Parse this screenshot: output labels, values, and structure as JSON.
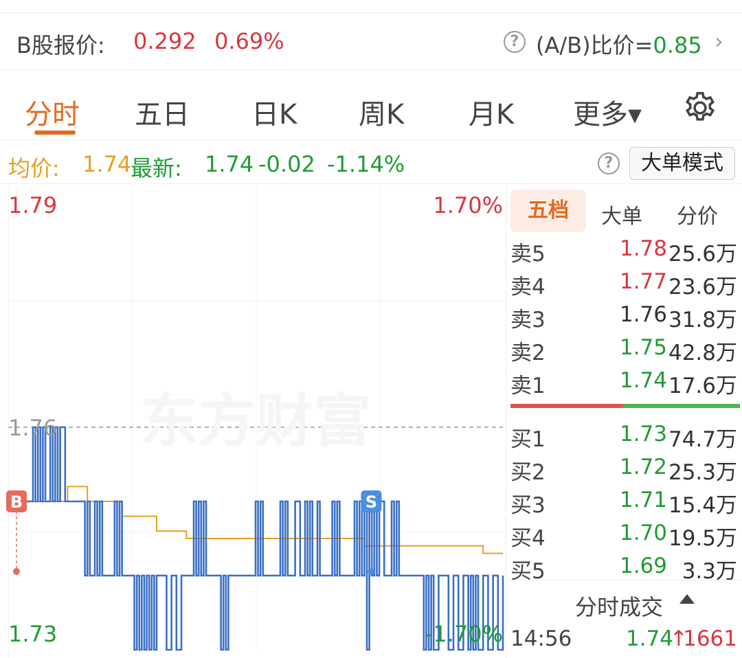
{
  "quote": {
    "label": "B股报价:",
    "price": "0.292",
    "change_pct": "0.69%",
    "ratio_label": "(A/B)比价=",
    "ratio_value": "0.85",
    "help": "?",
    "chevron": "›"
  },
  "tabs": [
    {
      "label": "分时",
      "active": true
    },
    {
      "label": "五日"
    },
    {
      "label": "日K"
    },
    {
      "label": "周K"
    },
    {
      "label": "月K"
    },
    {
      "label": "更多▾"
    }
  ],
  "settings_icon": "gear-icon",
  "avg_bar": {
    "avg_label": "均价:",
    "avg_value": "1.74",
    "latest_label": "最新:",
    "latest_value": "1.74",
    "change": "-0.02",
    "change_pct": "-1.14%",
    "help": "?",
    "big_order_mode": "大单模式"
  },
  "chart_data": {
    "type": "line",
    "ylim": [
      1.73,
      1.79
    ],
    "y_tick_labels": {
      "top": "1.79",
      "mid": "1.76",
      "bottom": "1.73"
    },
    "pct_labels": {
      "top": "1.70%",
      "bottom": "-1.70%"
    },
    "reference_price": 1.76,
    "markers": [
      {
        "label": "B",
        "x": 0.0,
        "price": 1.75
      },
      {
        "label": "S",
        "x": 0.72,
        "price": 1.75
      }
    ],
    "watermark": "东方财富",
    "series": [
      {
        "color": "#3a6fc4",
        "x": [
          0.0,
          0.02,
          0.045,
          0.05,
          0.055,
          0.06,
          0.065,
          0.07,
          0.075,
          0.08,
          0.085,
          0.09,
          0.095,
          0.1,
          0.105,
          0.11,
          0.115,
          0.12,
          0.125,
          0.13,
          0.135,
          0.14,
          0.15,
          0.155,
          0.16,
          0.165,
          0.17,
          0.175,
          0.18,
          0.185,
          0.19,
          0.2,
          0.21,
          0.215,
          0.22,
          0.225,
          0.23,
          0.24,
          0.25,
          0.255,
          0.26,
          0.265,
          0.27,
          0.275,
          0.28,
          0.285,
          0.29,
          0.295,
          0.3,
          0.31,
          0.32,
          0.33,
          0.34,
          0.35,
          0.36,
          0.37,
          0.375,
          0.38,
          0.385,
          0.39,
          0.395,
          0.4,
          0.405,
          0.41,
          0.42,
          0.43,
          0.435,
          0.44,
          0.445,
          0.45,
          0.46,
          0.47,
          0.48,
          0.49,
          0.5,
          0.505,
          0.51,
          0.515,
          0.52,
          0.53,
          0.54,
          0.55,
          0.555,
          0.56,
          0.565,
          0.57,
          0.58,
          0.59,
          0.6,
          0.605,
          0.61,
          0.615,
          0.62,
          0.625,
          0.63,
          0.64,
          0.65,
          0.655,
          0.66,
          0.665,
          0.67,
          0.68,
          0.69,
          0.7,
          0.705,
          0.71,
          0.715,
          0.72,
          0.725,
          0.73,
          0.735,
          0.74,
          0.745,
          0.75,
          0.76,
          0.77,
          0.775,
          0.78,
          0.785,
          0.79,
          0.8,
          0.81,
          0.82,
          0.83,
          0.84,
          0.845,
          0.85,
          0.855,
          0.86,
          0.87,
          0.88,
          0.89,
          0.9,
          0.91,
          0.92,
          0.93,
          0.935,
          0.94,
          0.945,
          0.95,
          0.96,
          0.97,
          0.98,
          0.99,
          1.0
        ],
        "values": [
          1.75,
          1.75,
          1.75,
          1.76,
          1.75,
          1.76,
          1.75,
          1.76,
          1.75,
          1.75,
          1.76,
          1.75,
          1.76,
          1.75,
          1.76,
          1.76,
          1.75,
          1.75,
          1.75,
          1.75,
          1.75,
          1.75,
          1.75,
          1.74,
          1.75,
          1.74,
          1.74,
          1.75,
          1.74,
          1.75,
          1.74,
          1.74,
          1.74,
          1.75,
          1.74,
          1.75,
          1.74,
          1.74,
          1.74,
          1.73,
          1.74,
          1.73,
          1.74,
          1.73,
          1.74,
          1.73,
          1.74,
          1.73,
          1.74,
          1.74,
          1.73,
          1.74,
          1.73,
          1.74,
          1.74,
          1.74,
          1.75,
          1.74,
          1.75,
          1.74,
          1.75,
          1.74,
          1.74,
          1.74,
          1.74,
          1.73,
          1.74,
          1.73,
          1.74,
          1.74,
          1.74,
          1.74,
          1.74,
          1.74,
          1.75,
          1.74,
          1.75,
          1.74,
          1.74,
          1.74,
          1.74,
          1.75,
          1.74,
          1.75,
          1.74,
          1.74,
          1.75,
          1.74,
          1.75,
          1.74,
          1.75,
          1.74,
          1.74,
          1.75,
          1.74,
          1.74,
          1.74,
          1.75,
          1.74,
          1.75,
          1.74,
          1.74,
          1.74,
          1.75,
          1.74,
          1.75,
          1.74,
          1.75,
          1.73,
          1.75,
          1.74,
          1.75,
          1.74,
          1.75,
          1.74,
          1.74,
          1.75,
          1.74,
          1.75,
          1.74,
          1.74,
          1.74,
          1.74,
          1.74,
          1.73,
          1.74,
          1.73,
          1.74,
          1.73,
          1.74,
          1.74,
          1.73,
          1.74,
          1.73,
          1.74,
          1.73,
          1.74,
          1.73,
          1.74,
          1.73,
          1.74,
          1.73,
          1.74,
          1.73,
          1.74
        ]
      },
      {
        "color": "#e6a020",
        "x": [
          0.0,
          0.1,
          0.12,
          0.15,
          0.16,
          0.22,
          0.23,
          0.29,
          0.3,
          0.35,
          0.36,
          0.45,
          0.55,
          0.6,
          0.62,
          0.7,
          0.72,
          0.75,
          0.8,
          0.9,
          0.95,
          0.96,
          1.0
        ],
        "values": [
          1.75,
          1.75,
          1.752,
          1.752,
          1.75,
          1.75,
          1.748,
          1.748,
          1.746,
          1.746,
          1.745,
          1.745,
          1.745,
          1.745,
          1.745,
          1.745,
          1.744,
          1.744,
          1.744,
          1.744,
          1.744,
          1.743,
          1.743
        ]
      }
    ]
  },
  "order_book": {
    "tabs": [
      "五档",
      "大单",
      "分价"
    ],
    "asks": [
      {
        "label": "卖5",
        "price": "1.78",
        "vol": "25.6万",
        "color": "#d9363e"
      },
      {
        "label": "卖4",
        "price": "1.77",
        "vol": "23.6万",
        "color": "#d9363e"
      },
      {
        "label": "卖3",
        "price": "1.76",
        "vol": "31.8万",
        "color": "#333333"
      },
      {
        "label": "卖2",
        "price": "1.75",
        "vol": "42.8万",
        "color": "#1f9c33"
      },
      {
        "label": "卖1",
        "price": "1.74",
        "vol": "17.6万",
        "color": "#1f9c33"
      }
    ],
    "bids": [
      {
        "label": "买1",
        "price": "1.73",
        "vol": "74.7万",
        "color": "#1f9c33"
      },
      {
        "label": "买2",
        "price": "1.72",
        "vol": "25.3万",
        "color": "#1f9c33"
      },
      {
        "label": "买3",
        "price": "1.71",
        "vol": "15.4万",
        "color": "#1f9c33"
      },
      {
        "label": "买4",
        "price": "1.70",
        "vol": "19.5万",
        "color": "#1f9c33"
      },
      {
        "label": "买5",
        "price": "1.69",
        "vol": "3.3万",
        "color": "#1f9c33"
      }
    ],
    "trades_title": "分时成交",
    "last_trade": {
      "time": "14:56",
      "price": "1.74",
      "arrow": "↑",
      "volume": "1661"
    }
  }
}
